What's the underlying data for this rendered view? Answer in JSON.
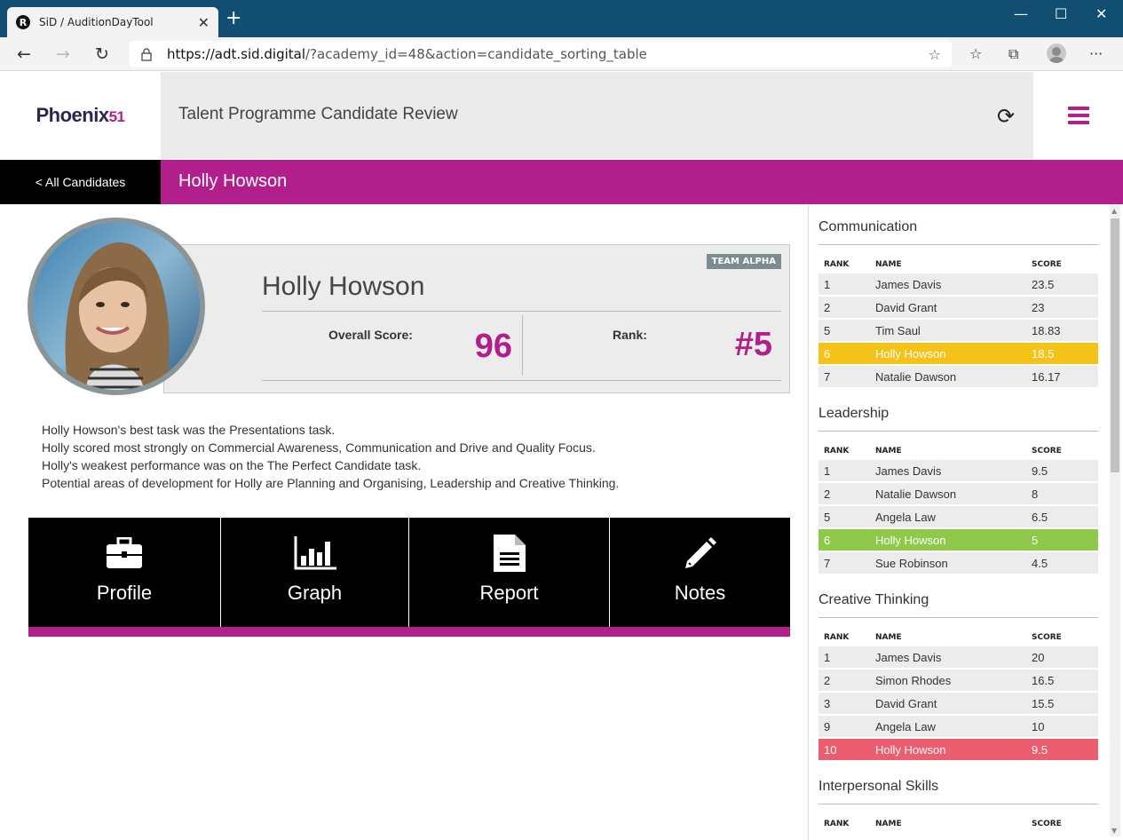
{
  "browser": {
    "tab_title": "SiD / AuditionDayTool",
    "url_host": "https://adt.sid.digital",
    "url_path": "/?academy_id=48&action=candidate_sorting_table"
  },
  "app": {
    "logo_text": "Phoenix",
    "logo_num": "51",
    "title": "Talent Programme Candidate Review"
  },
  "namebar": {
    "back_label": "< All Candidates",
    "candidate_name": "Holly Howson"
  },
  "card": {
    "team": "TEAM ALPHA",
    "name": "Holly Howson",
    "overall_label": "Overall Score:",
    "overall_value": "96",
    "rank_label": "Rank:",
    "rank_value": "#5"
  },
  "summary": [
    "Holly Howson's best task was the Presentations task.",
    "Holly scored most strongly on Commercial Awareness, Communication and Drive and Quality Focus.",
    "Holly's weakest performance was on the The Perfect Candidate task.",
    "Potential areas of development for Holly are Planning and Organising, Leadership and Creative Thinking."
  ],
  "tiles": [
    {
      "label": "Profile",
      "icon": "briefcase-icon"
    },
    {
      "label": "Graph",
      "icon": "bar-chart-icon"
    },
    {
      "label": "Report",
      "icon": "document-icon"
    },
    {
      "label": "Notes",
      "icon": "pencil-icon"
    }
  ],
  "table_headers": {
    "rank": "RANK",
    "name": "NAME",
    "score": "SCORE"
  },
  "highlight_colors": {
    "yellow": "#f5c21a",
    "green": "#8fc94a",
    "red": "#ec5e6f"
  },
  "sections": [
    {
      "title": "Communication",
      "rows": [
        {
          "rank": "1",
          "name": "James Davis",
          "score": "23.5"
        },
        {
          "rank": "2",
          "name": "David Grant",
          "score": "23"
        },
        {
          "rank": "5",
          "name": "Tim Saul",
          "score": "18.83"
        },
        {
          "rank": "6",
          "name": "Holly Howson",
          "score": "18.5",
          "highlight": "yellow"
        },
        {
          "rank": "7",
          "name": "Natalie Dawson",
          "score": "16.17"
        }
      ]
    },
    {
      "title": "Leadership",
      "rows": [
        {
          "rank": "1",
          "name": "James Davis",
          "score": "9.5"
        },
        {
          "rank": "2",
          "name": "Natalie Dawson",
          "score": "8"
        },
        {
          "rank": "5",
          "name": "Angela Law",
          "score": "6.5"
        },
        {
          "rank": "6",
          "name": "Holly Howson",
          "score": "5",
          "highlight": "green"
        },
        {
          "rank": "7",
          "name": "Sue Robinson",
          "score": "4.5"
        }
      ]
    },
    {
      "title": "Creative Thinking",
      "rows": [
        {
          "rank": "1",
          "name": "James Davis",
          "score": "20"
        },
        {
          "rank": "2",
          "name": "Simon Rhodes",
          "score": "16.5"
        },
        {
          "rank": "3",
          "name": "David Grant",
          "score": "15.5"
        },
        {
          "rank": "9",
          "name": "Angela Law",
          "score": "10"
        },
        {
          "rank": "10",
          "name": "Holly Howson",
          "score": "9.5",
          "highlight": "red"
        }
      ]
    },
    {
      "title": "Interpersonal Skills",
      "rows": []
    }
  ]
}
